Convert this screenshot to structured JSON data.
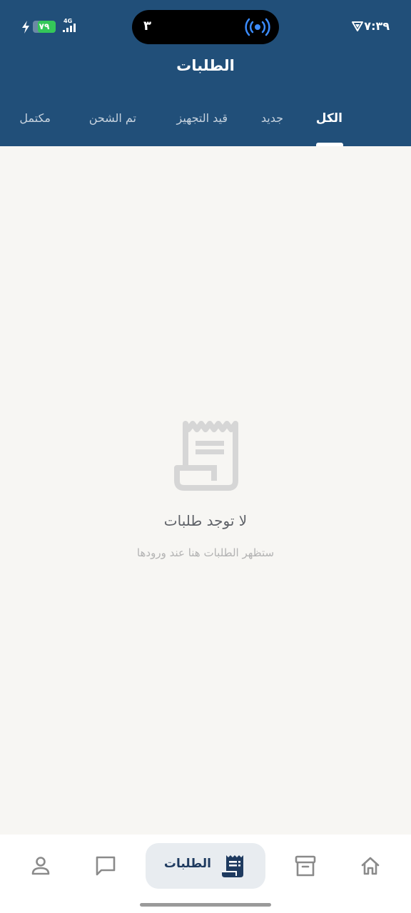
{
  "status_bar": {
    "time": "٧:٣٩",
    "island_count": "٣",
    "network": "4G",
    "battery_label": "٧٩",
    "battery_level": 0.79
  },
  "header": {
    "title": "الطلبات"
  },
  "tabs": [
    {
      "label": "الكل",
      "active": true
    },
    {
      "label": "جديد"
    },
    {
      "label": "قيد التجهيز"
    },
    {
      "label": "تم الشحن"
    },
    {
      "label": "مكتمل"
    }
  ],
  "empty_state": {
    "icon": "receipt-icon",
    "title": "لا توجد طلبات",
    "subtitle": "ستظهر الطلبات هنا عند ورودها"
  },
  "bottom_nav": {
    "items": [
      {
        "icon": "home-icon"
      },
      {
        "icon": "archive-icon"
      },
      {
        "icon": "receipt-icon",
        "label": "الطلبات",
        "active": true
      },
      {
        "icon": "chat-icon"
      },
      {
        "icon": "person-icon"
      }
    ]
  },
  "colors": {
    "header_bg": "#214f79",
    "page_bg": "#f7f6f3",
    "accent": "#1e3a5f"
  }
}
